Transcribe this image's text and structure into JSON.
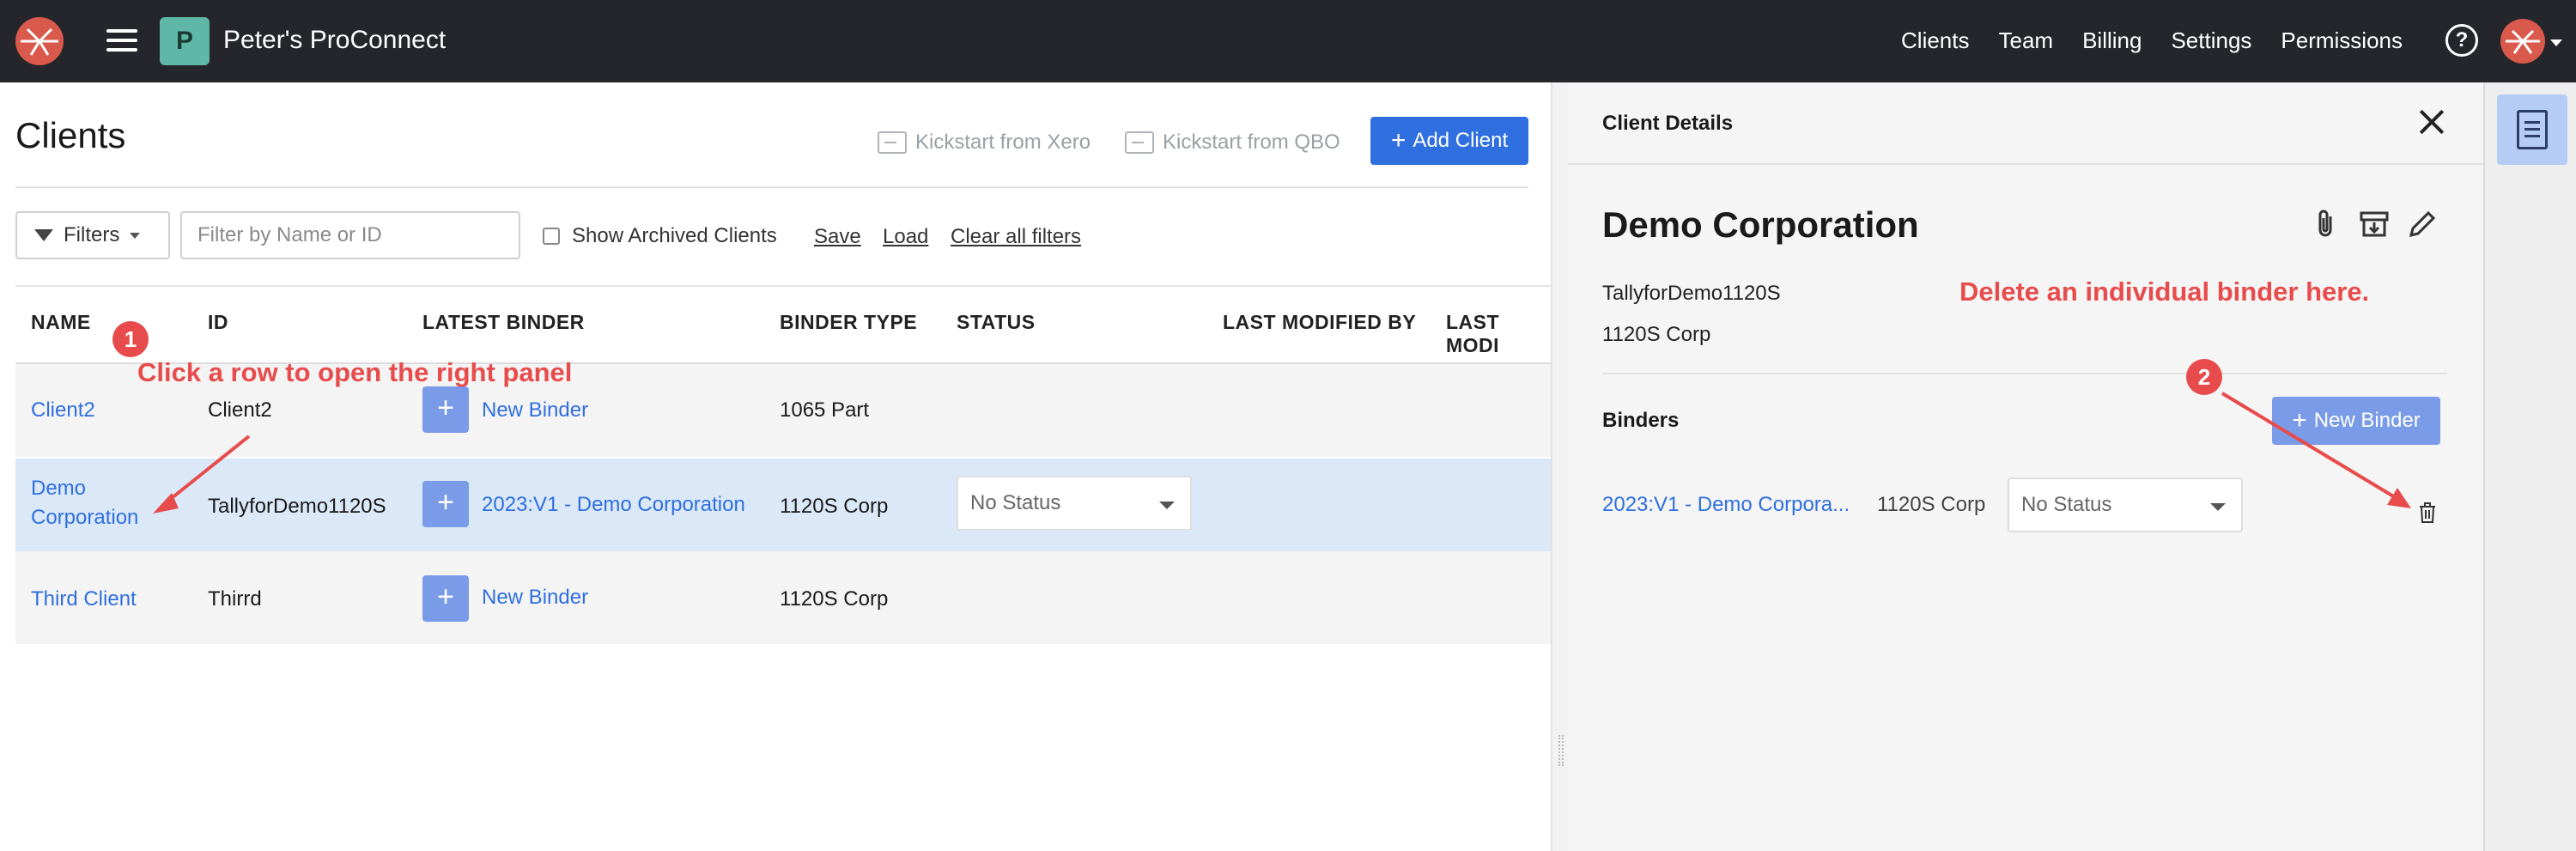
{
  "app": {
    "org_badge": "P",
    "org_name": "Peter's ProConnect"
  },
  "topnav": {
    "items": [
      "Clients",
      "Team",
      "Billing",
      "Settings",
      "Permissions"
    ],
    "help": "?"
  },
  "page": {
    "title": "Clients",
    "kickstart_xero": "Kickstart from Xero",
    "kickstart_qbo": "Kickstart from QBO",
    "add_client": "Add Client",
    "filters": "Filters",
    "filter_placeholder": "Filter by Name or ID",
    "show_archived": "Show Archived Clients",
    "save": "Save",
    "load": "Load",
    "clear": "Clear all filters"
  },
  "table": {
    "headers": [
      "NAME",
      "ID",
      "LATEST BINDER",
      "BINDER TYPE",
      "STATUS",
      "LAST MODIFIED BY",
      "LAST MODI"
    ],
    "rows": [
      {
        "name": "Client2",
        "id": "Client2",
        "binder": "New Binder",
        "binder_type": "1065 Part",
        "status": ""
      },
      {
        "name": "Demo Corporation",
        "id": "TallyforDemo1120S",
        "binder": "2023:V1 - Demo Corporation",
        "binder_type": "1120S Corp",
        "status": "No Status"
      },
      {
        "name": "Third Client",
        "id": "Thirrd",
        "binder": "New Binder",
        "binder_type": "1120S Corp",
        "status": ""
      }
    ]
  },
  "annotations": {
    "one": "1",
    "one_text": "Click a row to open the right panel",
    "two": "2",
    "two_text": "Delete an individual binder here."
  },
  "panel": {
    "title": "Client Details",
    "client_name": "Demo Corporation",
    "client_id": "TallyforDemo1120S",
    "client_type": "1120S Corp",
    "binders_label": "Binders",
    "new_binder": "New Binder",
    "binders": [
      {
        "name": "2023:V1 - Demo Corpora...",
        "type": "1120S Corp",
        "status": "No Status"
      }
    ]
  },
  "colors": {
    "accent": "#2f6fe0",
    "annotation": "#e84b4b",
    "selected_row": "#dbe8f8",
    "topbar": "#25262b"
  }
}
